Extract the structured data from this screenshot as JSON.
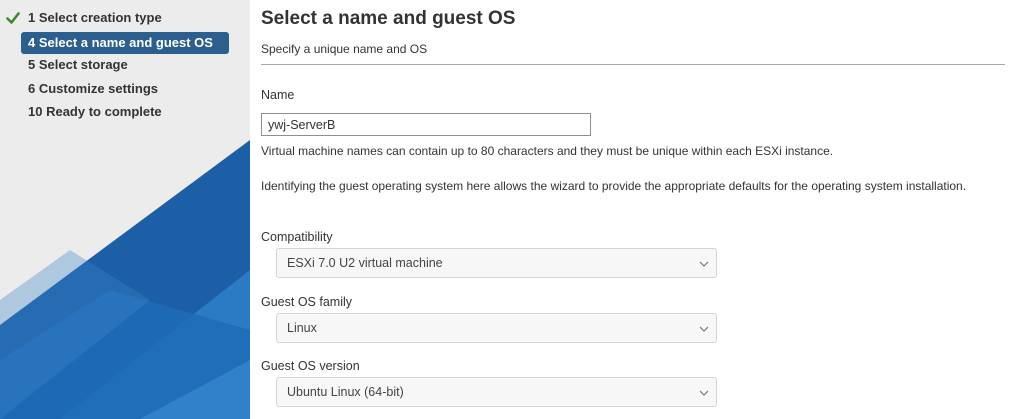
{
  "steps": [
    {
      "label": "1 Select creation type",
      "state": "done"
    },
    {
      "label": "4 Select a name and guest OS",
      "state": "active"
    },
    {
      "label": "5 Select storage",
      "state": "pending"
    },
    {
      "label": "6 Customize settings",
      "state": "pending"
    },
    {
      "label": "10 Ready to complete",
      "state": "pending"
    }
  ],
  "page": {
    "title": "Select a name and guest OS",
    "subtitle": "Specify a unique name and OS"
  },
  "name": {
    "label": "Name",
    "value": "ywj-ServerB",
    "help": "Virtual machine names can contain up to 80 characters and they must be unique within each ESXi instance."
  },
  "guest_os_info": "Identifying the guest operating system here allows the wizard to provide the appropriate defaults for the operating system installation.",
  "compatibility": {
    "label": "Compatibility",
    "value": "ESXi 7.0 U2 virtual machine"
  },
  "os_family": {
    "label": "Guest OS family",
    "value": "Linux"
  },
  "os_version": {
    "label": "Guest OS version",
    "value": "Ubuntu Linux (64-bit)"
  },
  "colors": {
    "active_step": "#2c5f8d",
    "check": "#3a8a2c",
    "sidebar_blue": "#1f6bb8"
  },
  "icons": {
    "done_step": "check-icon",
    "dropdown": "chevron-down-icon"
  }
}
